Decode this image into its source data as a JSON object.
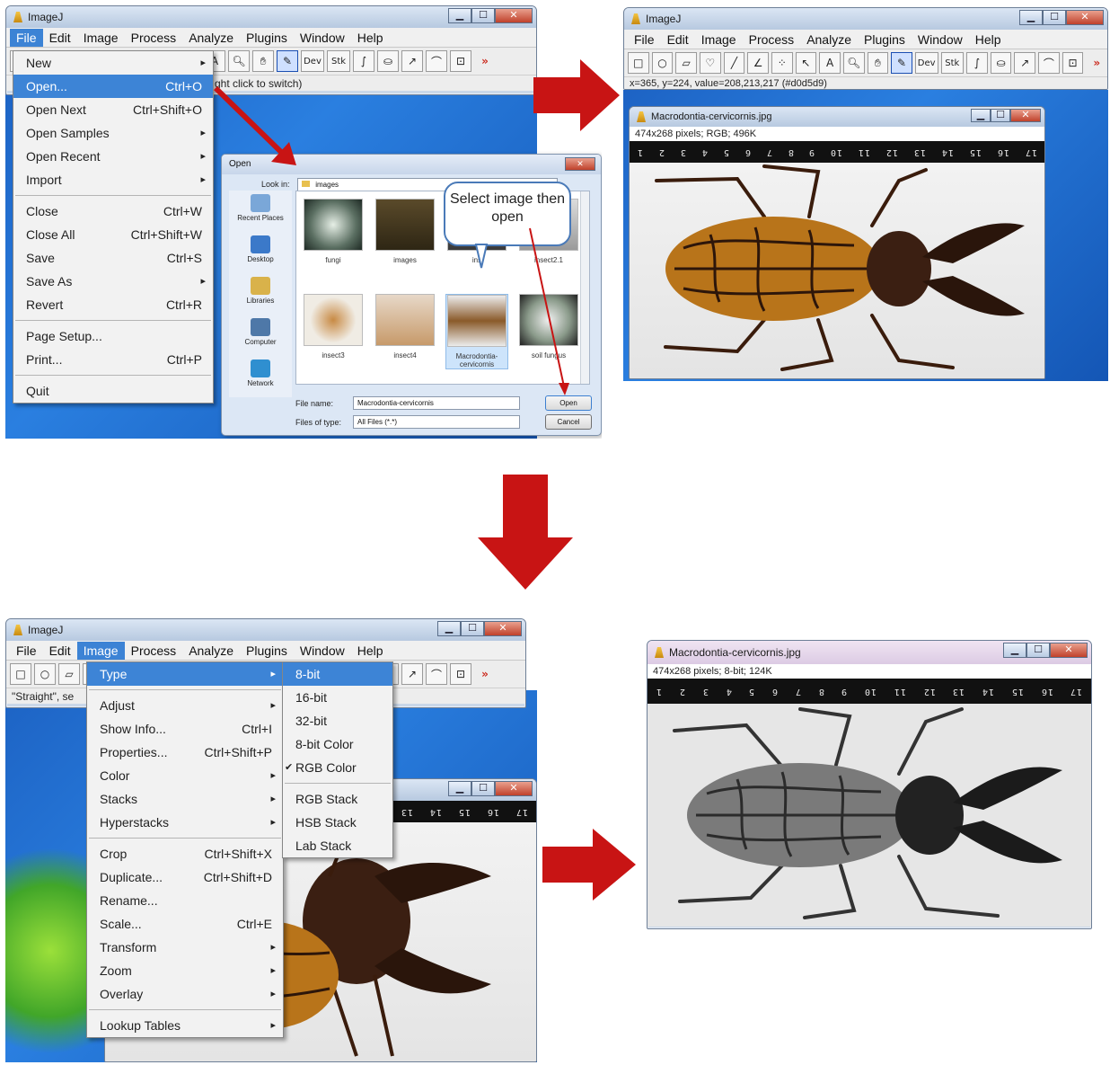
{
  "colors": {
    "arrow": "#c81414",
    "menu_highlight": "#3d84d6",
    "desktop": "#1d63c4"
  },
  "panel1": {
    "window_title": "ImageJ",
    "menubar": [
      "File",
      "Edit",
      "Image",
      "Process",
      "Analyze",
      "Plugins",
      "Window",
      "Help"
    ],
    "status_text": "ght click to switch)",
    "file_menu": [
      {
        "label": "New",
        "shortcut": "",
        "submenu": true
      },
      {
        "label": "Open...",
        "shortcut": "Ctrl+O",
        "highlight": true
      },
      {
        "label": "Open Next",
        "shortcut": "Ctrl+Shift+O"
      },
      {
        "label": "Open Samples",
        "shortcut": "",
        "submenu": true
      },
      {
        "label": "Open Recent",
        "shortcut": "",
        "submenu": true
      },
      {
        "label": "Import",
        "shortcut": "",
        "submenu": true
      },
      {
        "sep": true
      },
      {
        "label": "Close",
        "shortcut": "Ctrl+W"
      },
      {
        "label": "Close All",
        "shortcut": "Ctrl+Shift+W"
      },
      {
        "label": "Save",
        "shortcut": "Ctrl+S"
      },
      {
        "label": "Save As",
        "shortcut": "",
        "submenu": true
      },
      {
        "label": "Revert",
        "shortcut": "Ctrl+R"
      },
      {
        "sep": true
      },
      {
        "label": "Page Setup...",
        "shortcut": ""
      },
      {
        "label": "Print...",
        "shortcut": "Ctrl+P"
      },
      {
        "sep": true
      },
      {
        "label": "Quit",
        "shortcut": ""
      }
    ],
    "open_dialog": {
      "title": "Open",
      "look_in_label": "Look in:",
      "look_in_value": "images",
      "places": [
        "Recent Places",
        "Desktop",
        "Libraries",
        "Computer",
        "Network"
      ],
      "files": [
        {
          "name": "fungi"
        },
        {
          "name": "images"
        },
        {
          "name": "ins"
        },
        {
          "name": "insect2.1"
        },
        {
          "name": "insect3"
        },
        {
          "name": "insect4"
        },
        {
          "name": "Macrodontia-cervicornis",
          "selected": true
        },
        {
          "name": "soil fungus"
        }
      ],
      "file_name_label": "File name:",
      "file_name_value": "Macrodontia-cervicornis",
      "file_type_label": "Files of type:",
      "file_type_value": "All Files (*.*)",
      "open_button": "Open",
      "cancel_button": "Cancel"
    },
    "callout": "Select image then open"
  },
  "panel2": {
    "window_title": "ImageJ",
    "menubar": [
      "File",
      "Edit",
      "Image",
      "Process",
      "Analyze",
      "Plugins",
      "Window",
      "Help"
    ],
    "status_text": "x=365, y=224, value=208,213,217 (#d0d5d9)",
    "image_title": "Macrodontia-cervicornis.jpg",
    "image_info": "474x268 pixels; RGB; 496K"
  },
  "panel3": {
    "window_title": "ImageJ",
    "menubar": [
      "File",
      "Edit",
      "Image",
      "Process",
      "Analyze",
      "Plugins",
      "Window",
      "Help"
    ],
    "status_text": "\"Straight\", se",
    "image_menu": [
      {
        "label": "Type",
        "shortcut": "",
        "submenu": true,
        "highlight": true
      },
      {
        "sep": true
      },
      {
        "label": "Adjust",
        "shortcut": "",
        "submenu": true
      },
      {
        "label": "Show Info...",
        "shortcut": "Ctrl+I"
      },
      {
        "label": "Properties...",
        "shortcut": "Ctrl+Shift+P"
      },
      {
        "label": "Color",
        "shortcut": "",
        "submenu": true
      },
      {
        "label": "Stacks",
        "shortcut": "",
        "submenu": true
      },
      {
        "label": "Hyperstacks",
        "shortcut": "",
        "submenu": true
      },
      {
        "sep": true
      },
      {
        "label": "Crop",
        "shortcut": "Ctrl+Shift+X"
      },
      {
        "label": "Duplicate...",
        "shortcut": "Ctrl+Shift+D"
      },
      {
        "label": "Rename...",
        "shortcut": ""
      },
      {
        "label": "Scale...",
        "shortcut": "Ctrl+E"
      },
      {
        "label": "Transform",
        "shortcut": "",
        "submenu": true
      },
      {
        "label": "Zoom",
        "shortcut": "",
        "submenu": true
      },
      {
        "label": "Overlay",
        "shortcut": "",
        "submenu": true
      },
      {
        "sep": true
      },
      {
        "label": "Lookup Tables",
        "shortcut": "",
        "submenu": true
      }
    ],
    "type_submenu": [
      {
        "label": "8-bit",
        "highlight": true
      },
      {
        "label": "16-bit"
      },
      {
        "label": "32-bit"
      },
      {
        "label": "8-bit Color"
      },
      {
        "label": "RGB Color",
        "checked": true
      },
      {
        "sep": true
      },
      {
        "label": "RGB Stack"
      },
      {
        "label": "HSB Stack"
      },
      {
        "label": "Lab Stack"
      }
    ]
  },
  "panel4": {
    "image_title": "Macrodontia-cervicornis.jpg",
    "image_info": "474x268 pixels; 8-bit; 124K"
  },
  "ruler_labels": [
    "1",
    "2",
    "3",
    "4",
    "5",
    "6",
    "7",
    "8",
    "9",
    "10",
    "11",
    "12",
    "13",
    "14",
    "15",
    "16",
    "17"
  ]
}
